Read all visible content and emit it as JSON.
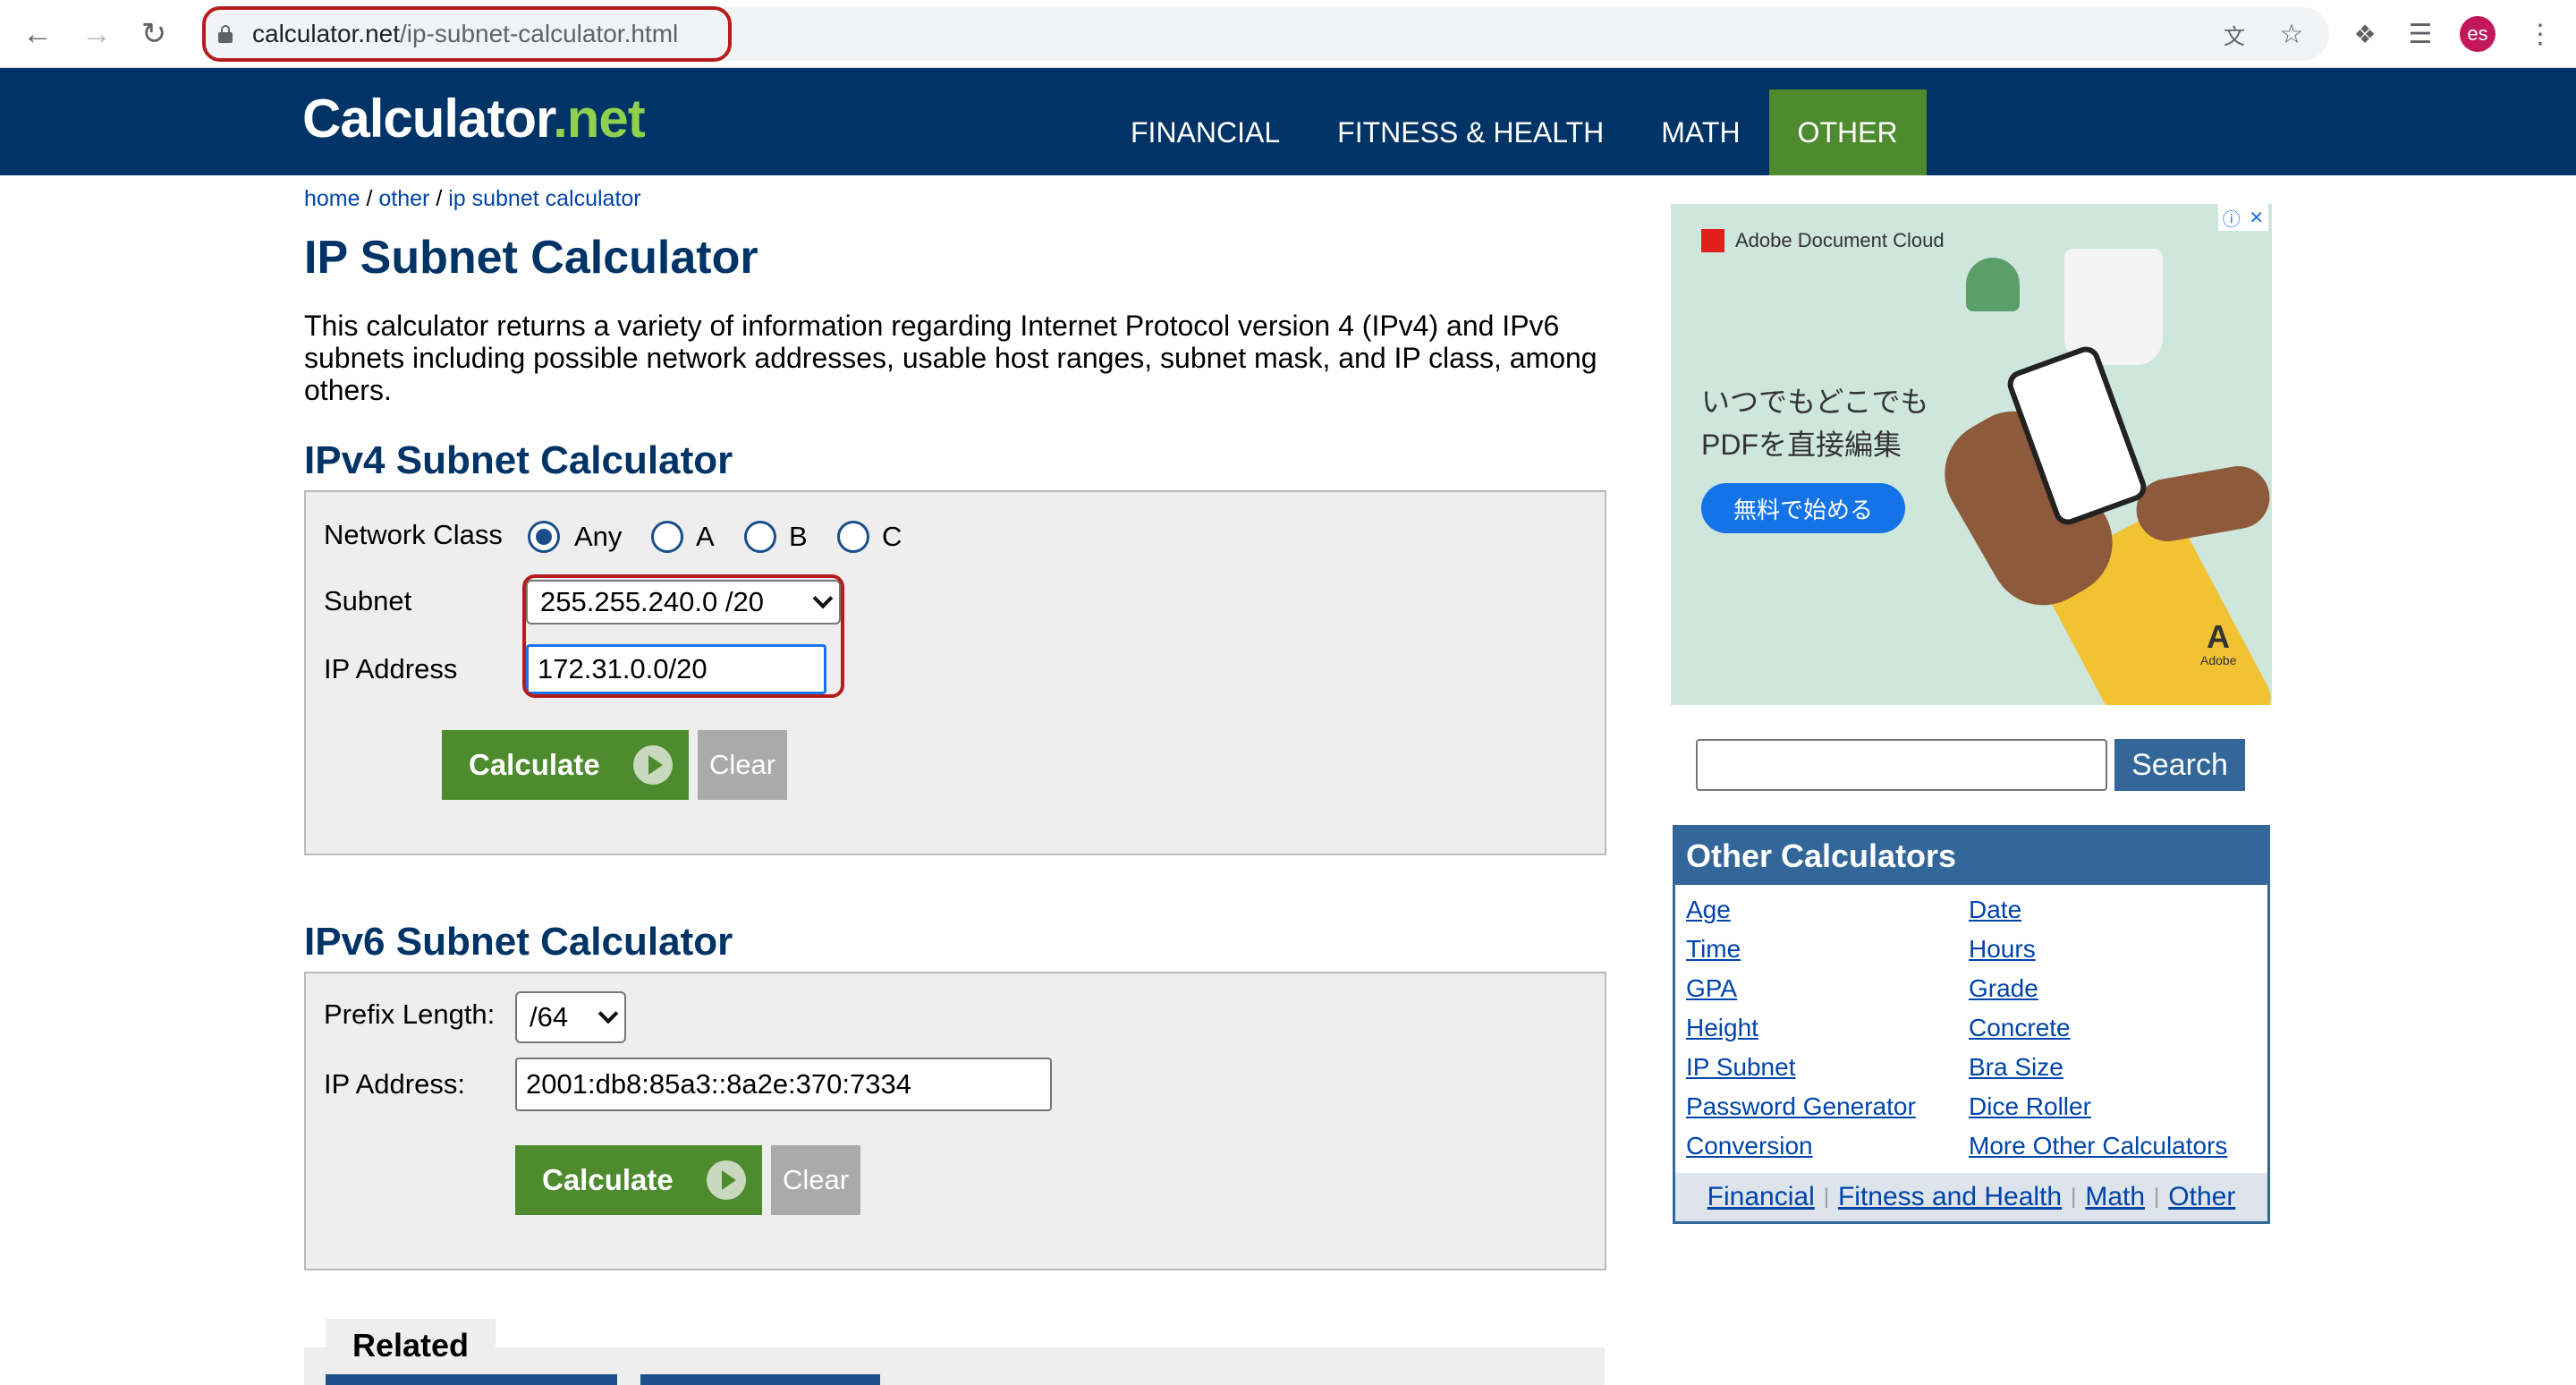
{
  "browser": {
    "url_host": "calculator.net",
    "url_path": "/ip-subnet-calculator.html",
    "profile_initials": "es",
    "icons": [
      "back-icon",
      "forward-icon",
      "reload-icon",
      "lock-icon",
      "translate-icon",
      "star-icon",
      "extensions-icon",
      "media-icon",
      "menu-icon"
    ]
  },
  "site": {
    "logo_main": "Calculator",
    "logo_dot": ".",
    "logo_tld": "net",
    "nav": [
      {
        "label": "FINANCIAL",
        "active": false
      },
      {
        "label": "FITNESS & HEALTH",
        "active": false
      },
      {
        "label": "MATH",
        "active": false
      },
      {
        "label": "OTHER",
        "active": true
      }
    ]
  },
  "breadcrumb": {
    "home": "home",
    "sep1": " / ",
    "other": "other",
    "sep2": " / ",
    "current": "ip subnet calculator"
  },
  "page": {
    "title": "IP Subnet Calculator",
    "intro": "This calculator returns a variety of information regarding Internet Protocol version 4 (IPv4) and IPv6 subnets including possible network addresses, usable host ranges, subnet mask, and IP class, among others."
  },
  "ipv4": {
    "heading": "IPv4 Subnet Calculator",
    "network_class_label": "Network Class",
    "classes": [
      {
        "label": "Any",
        "checked": true
      },
      {
        "label": "A",
        "checked": false
      },
      {
        "label": "B",
        "checked": false
      },
      {
        "label": "C",
        "checked": false
      }
    ],
    "subnet_label": "Subnet",
    "subnet_value": "255.255.240.0 /20",
    "ip_label": "IP Address",
    "ip_value": "172.31.0.0/20",
    "calculate": "Calculate",
    "clear": "Clear"
  },
  "ipv6": {
    "heading": "IPv6 Subnet Calculator",
    "prefix_label": "Prefix Length:",
    "prefix_value": "/64",
    "ip_label": "IP Address:",
    "ip_value": "2001:db8:85a3::8a2e:370:7334",
    "calculate": "Calculate",
    "clear": "Clear"
  },
  "related": {
    "tab": "Related"
  },
  "ad": {
    "brand": "Adobe Document Cloud",
    "line1": "いつでもどこでも",
    "line2": "PDFを直接編集",
    "cta": "無料で始める",
    "adobe": "Adobe"
  },
  "sidebar": {
    "search_button": "Search",
    "search_value": "",
    "other_calculators_title": "Other Calculators",
    "links_left": [
      "Age",
      "Time",
      "GPA",
      "Height",
      "IP Subnet",
      "Password Generator",
      "Conversion"
    ],
    "links_right": [
      "Date",
      "Hours",
      "Grade",
      "Concrete",
      "Bra Size",
      "Dice Roller",
      "More Other Calculators"
    ],
    "footer_links": [
      "Financial",
      "Fitness and Health",
      "Math",
      "Other"
    ],
    "footer_sep": "|"
  },
  "colors": {
    "header_bg": "#003366",
    "active_nav": "#4e8b2e",
    "heading": "#003366",
    "highlight": "#b51d1d",
    "link": "#0044aa"
  }
}
